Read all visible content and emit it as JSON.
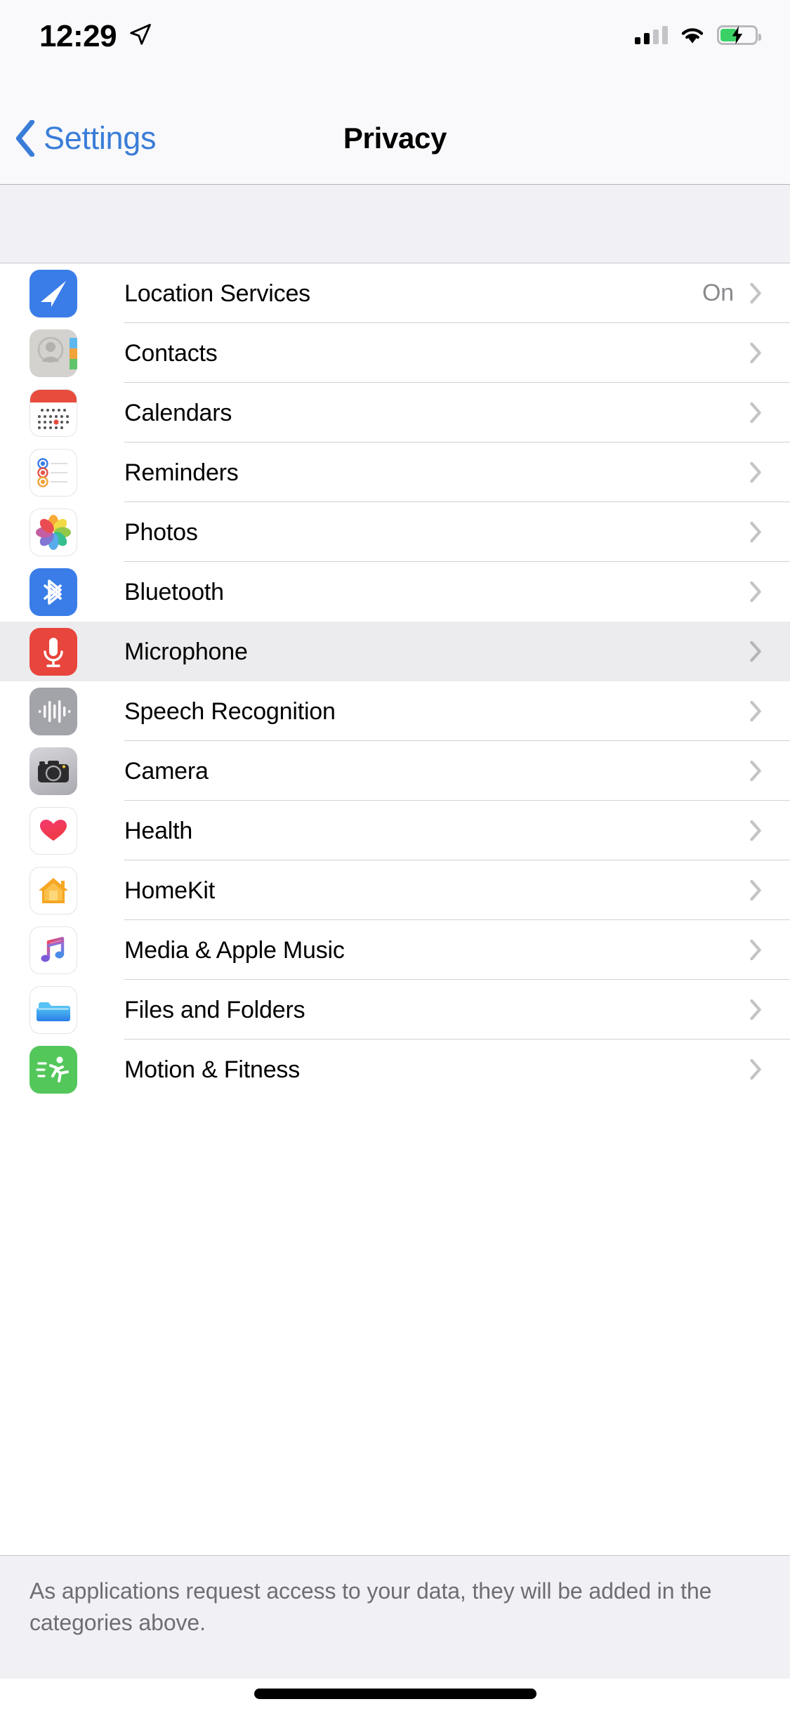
{
  "status_bar": {
    "time": "12:29",
    "location_icon": "location-arrow-icon",
    "cellular_icon": "cellular-signal-icon",
    "cellular_bars_filled": 2,
    "cellular_bars_total": 4,
    "wifi_icon": "wifi-icon",
    "battery_icon": "battery-charging-icon",
    "battery_color": "#3AD267"
  },
  "nav_bar": {
    "back_label": "Settings",
    "back_icon": "chevron-left-icon",
    "title": "Privacy",
    "tint_color": "#3A7DD8"
  },
  "list": {
    "items": [
      {
        "label": "Location Services",
        "value": "On",
        "icon": "location-services-icon"
      },
      {
        "label": "Contacts",
        "value": "",
        "icon": "contacts-icon"
      },
      {
        "label": "Calendars",
        "value": "",
        "icon": "calendar-icon"
      },
      {
        "label": "Reminders",
        "value": "",
        "icon": "reminders-icon"
      },
      {
        "label": "Photos",
        "value": "",
        "icon": "photos-icon"
      },
      {
        "label": "Bluetooth",
        "value": "",
        "icon": "bluetooth-icon"
      },
      {
        "label": "Microphone",
        "value": "",
        "icon": "microphone-icon",
        "selected": true
      },
      {
        "label": "Speech Recognition",
        "value": "",
        "icon": "speech-recognition-icon"
      },
      {
        "label": "Camera",
        "value": "",
        "icon": "camera-icon"
      },
      {
        "label": "Health",
        "value": "",
        "icon": "health-icon"
      },
      {
        "label": "HomeKit",
        "value": "",
        "icon": "homekit-icon"
      },
      {
        "label": "Media & Apple Music",
        "value": "",
        "icon": "music-icon"
      },
      {
        "label": "Files and Folders",
        "value": "",
        "icon": "files-folder-icon"
      },
      {
        "label": "Motion & Fitness",
        "value": "",
        "icon": "motion-fitness-icon"
      }
    ],
    "disclosure_icon": "chevron-right-icon"
  },
  "footer": {
    "text": "As applications request access to your data, they will be added in the categories above."
  },
  "home_indicator": {
    "name": "home-indicator"
  }
}
